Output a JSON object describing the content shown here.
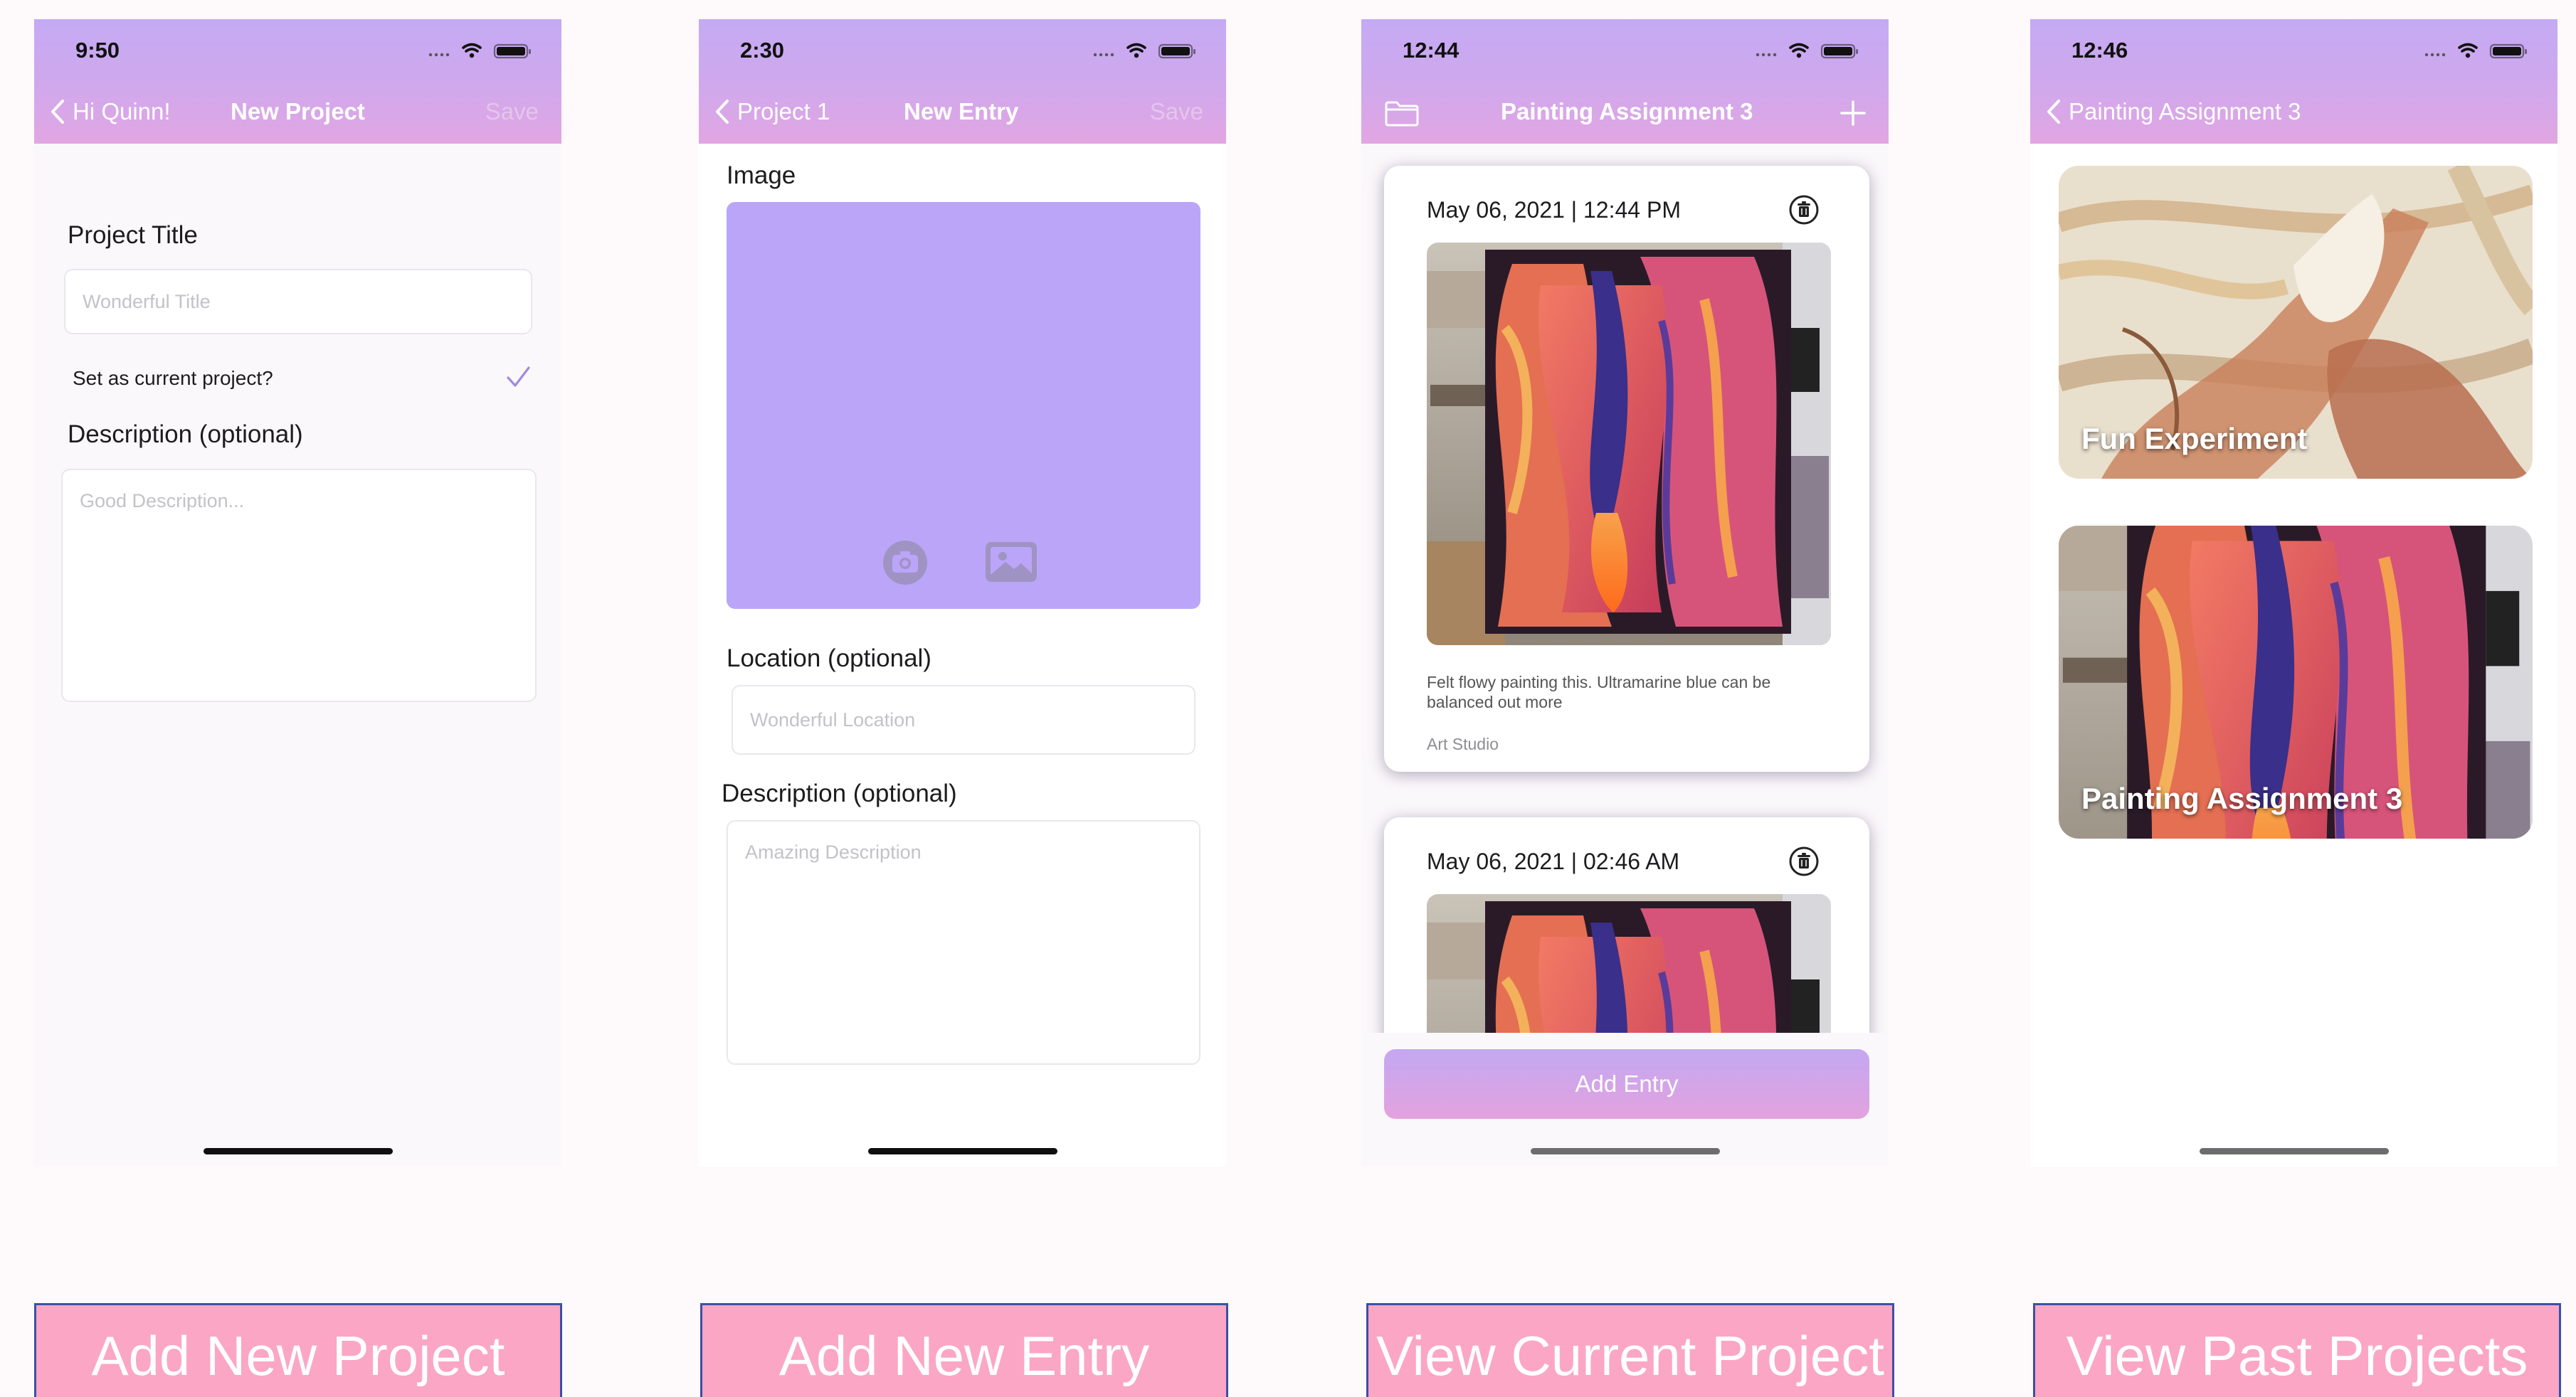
{
  "screens": [
    {
      "status_time": "9:50",
      "back_label": "Hi Quinn!",
      "title": "New Project",
      "save_label": "Save",
      "project_title_label": "Project Title",
      "title_placeholder": "Wonderful Title",
      "current_label": "Set as current project?",
      "current_checked": true,
      "description_label": "Description (optional)",
      "description_placeholder": "Good Description..."
    },
    {
      "status_time": "2:30",
      "back_label": "Project 1",
      "title": "New Entry",
      "save_label": "Save",
      "image_label": "Image",
      "location_label": "Location (optional)",
      "location_placeholder": "Wonderful Location",
      "description_label": "Description (optional)",
      "description_placeholder": "Amazing Description"
    },
    {
      "status_time": "12:44",
      "title": "Painting Assignment 3",
      "entries": [
        {
          "date": "May 06, 2021 | 12:44 PM",
          "note": "Felt flowy painting this. Ultramarine blue can be balanced out more",
          "location": "Art Studio"
        },
        {
          "date": "May 06, 2021 | 02:46 AM"
        }
      ],
      "add_entry_label": "Add Entry"
    },
    {
      "status_time": "12:46",
      "back_label": "Painting Assignment 3",
      "projects": [
        {
          "name": "Fun Experiment"
        },
        {
          "name": "Painting Assignment 3"
        }
      ]
    }
  ],
  "captions": [
    "Add New Project",
    "Add New Entry",
    "View Current Project",
    "View Past Projects"
  ],
  "icons": {
    "status": [
      "signal-icon",
      "wifi-icon",
      "battery-icon"
    ],
    "nav": [
      "chevron-left-icon",
      "folder-icon",
      "plus-icon"
    ],
    "entry": [
      "trash-icon",
      "camera-icon",
      "photo-library-icon"
    ]
  },
  "colors": {
    "nav_gradient_top": "#c4aaf4",
    "nav_gradient_bottom": "#e2a6e2",
    "image_placeholder": "#bba5f8",
    "accent_check": "#9f8bdc",
    "caption_bg": "#fba6c4",
    "caption_border": "#3c4fa8"
  }
}
